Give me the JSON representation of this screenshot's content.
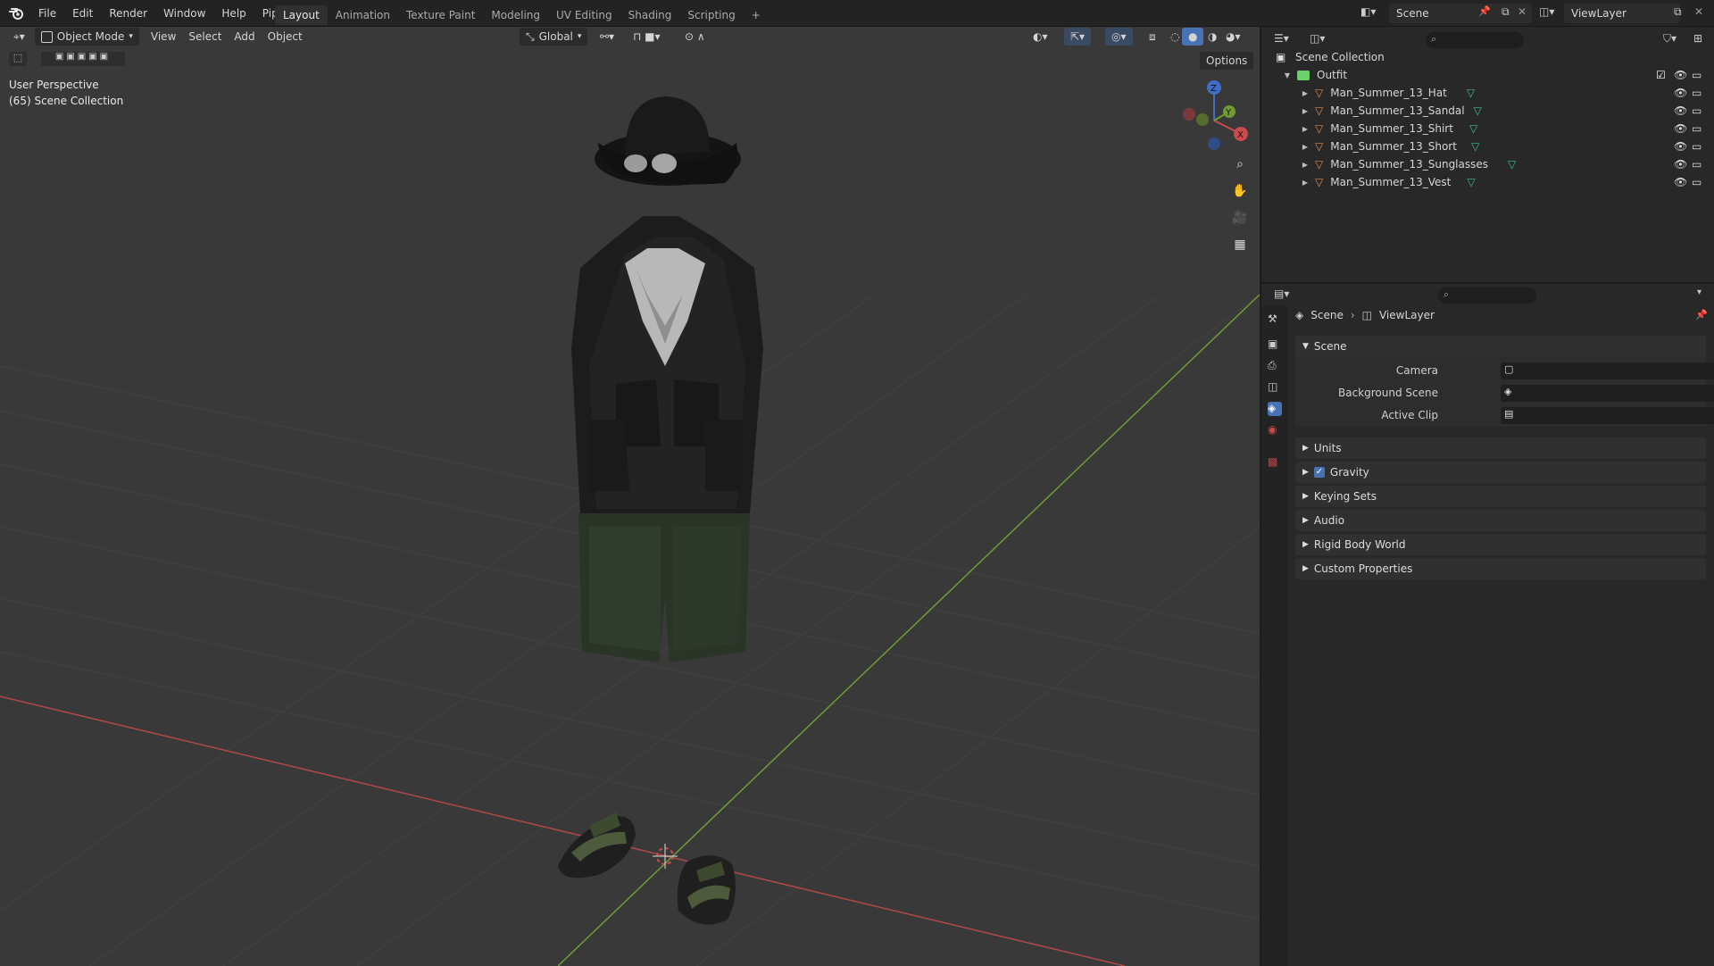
{
  "menu": [
    "File",
    "Edit",
    "Render",
    "Window",
    "Help",
    "Pipeline"
  ],
  "workspaces": [
    "Layout",
    "Animation",
    "Texture Paint",
    "Modeling",
    "UV Editing",
    "Shading",
    "Scripting",
    "+"
  ],
  "active_workspace": "Layout",
  "scene_name": "Scene",
  "view_layer_name": "ViewLayer",
  "viewport": {
    "mode": "Object Mode",
    "menus": [
      "View",
      "Select",
      "Add",
      "Object"
    ],
    "orientation": "Global",
    "options_label": "Options",
    "perspective_label": "User Perspective",
    "collection_label": "(65) Scene Collection",
    "gizmo_axes": {
      "z": "Z",
      "y": "Y",
      "x": "X"
    }
  },
  "outliner": {
    "root": "Scene Collection",
    "collection": "Outfit",
    "objects": [
      "Man_Summer_13_Hat",
      "Man_Summer_13_Sandal",
      "Man_Summer_13_Shirt",
      "Man_Summer_13_Short",
      "Man_Summer_13_Sunglasses",
      "Man_Summer_13_Vest"
    ]
  },
  "properties": {
    "breadcrumb": {
      "scene": "Scene",
      "view_layer": "ViewLayer"
    },
    "scene_panel": "Scene",
    "fields": {
      "camera": "Camera",
      "background_scene": "Background Scene",
      "active_clip": "Active Clip"
    },
    "panels": [
      "Units",
      "Gravity",
      "Keying Sets",
      "Audio",
      "Rigid Body World",
      "Custom Properties"
    ],
    "gravity_checked": true
  },
  "colors": {
    "accent": "#4772b3",
    "viewport_bg": "#393939",
    "x_axis": "#c94b4b",
    "y_axis": "#7fa53b",
    "mesh_icon": "#e5894a",
    "collection_icon": "#6bd16b"
  }
}
